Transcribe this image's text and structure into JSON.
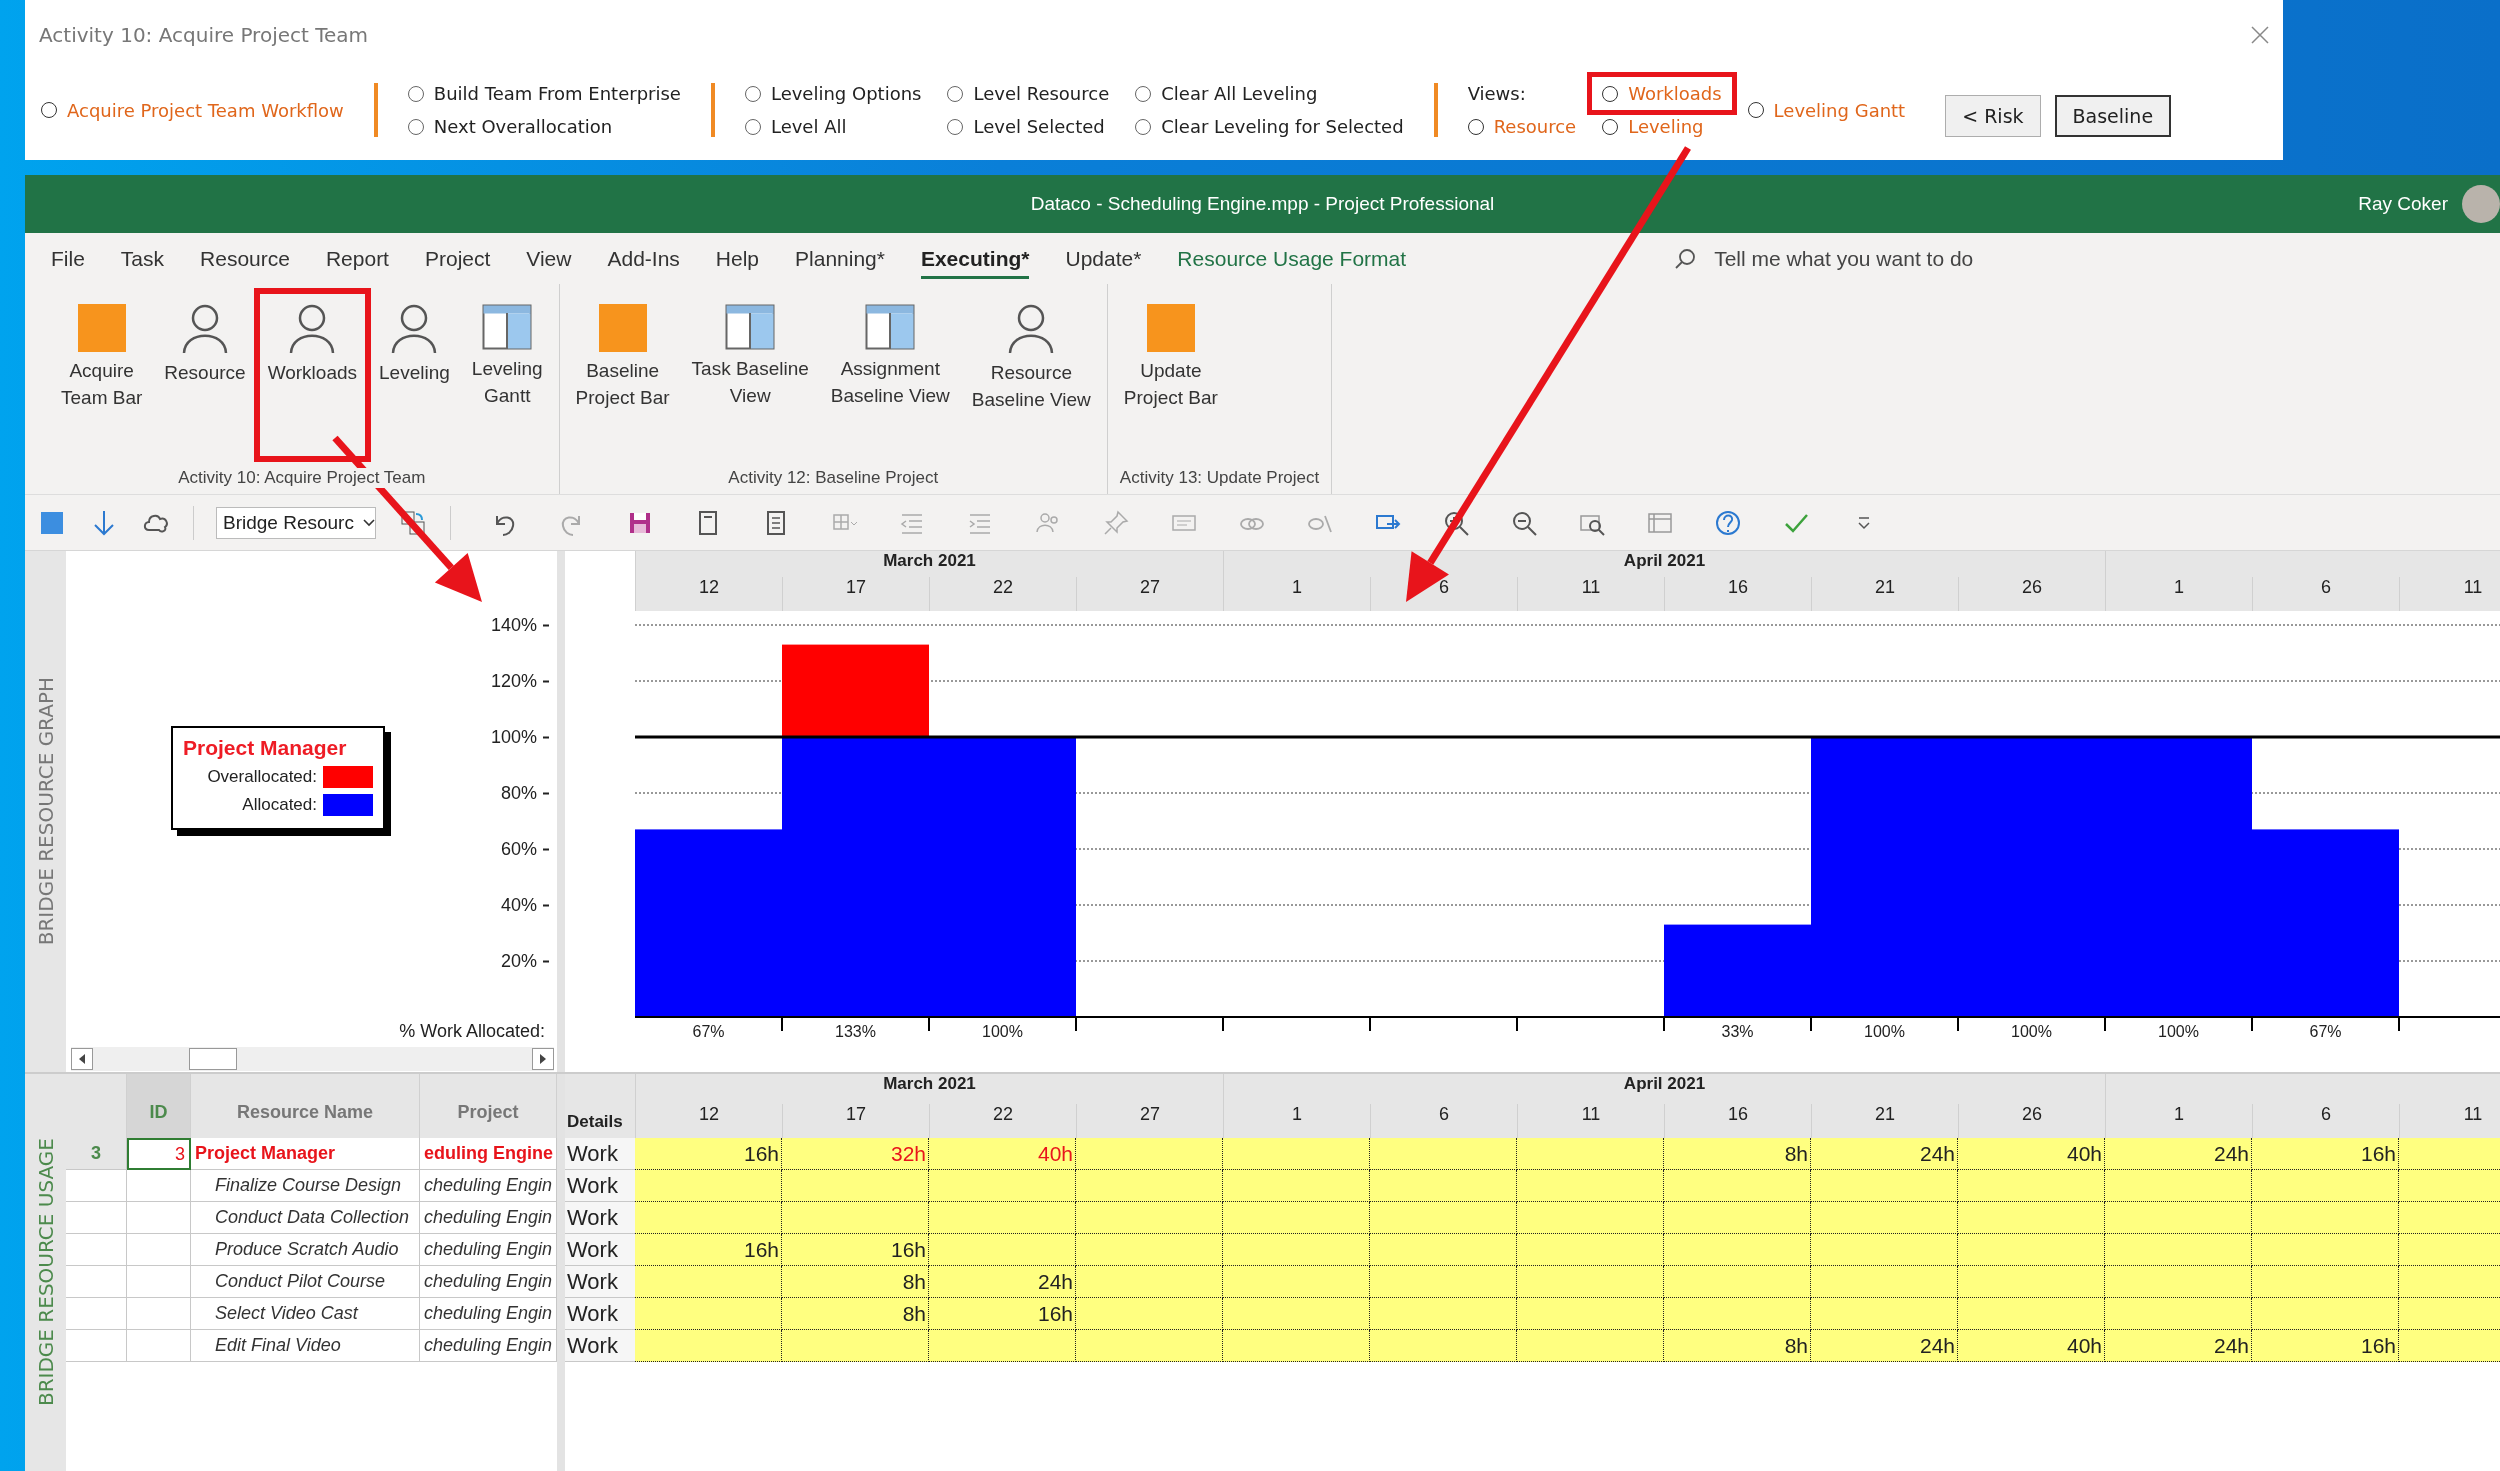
{
  "dialog": {
    "title": "Activity 10: Acquire Project Team",
    "groups": [
      {
        "items": [
          {
            "kind": "radio",
            "label": "Acquire Project Team Workflow",
            "accent": true,
            "selected": false,
            "annotated": false
          }
        ]
      },
      {
        "items": [
          {
            "kind": "radio",
            "label": "Build Team From Enterprise",
            "accent": false,
            "selected": false,
            "annotated": false
          },
          {
            "kind": "radio",
            "label": "Next Overallocation",
            "accent": false,
            "selected": false,
            "annotated": false
          }
        ]
      },
      {
        "items": [
          {
            "kind": "radio",
            "label": "Leveling Options",
            "accent": false,
            "selected": false,
            "annotated": false
          },
          {
            "kind": "radio",
            "label": "Level All",
            "accent": false,
            "selected": false,
            "annotated": false
          },
          {
            "kind": "radio",
            "label": "Level Resource",
            "accent": false,
            "selected": false,
            "annotated": false
          },
          {
            "kind": "radio",
            "label": "Level Selected",
            "accent": false,
            "selected": false,
            "annotated": false
          },
          {
            "kind": "radio",
            "label": "Clear All Leveling",
            "accent": false,
            "selected": false,
            "annotated": false
          },
          {
            "kind": "radio",
            "label": "Clear Leveling for Selected",
            "accent": false,
            "selected": false,
            "annotated": false
          }
        ]
      },
      {
        "items": [
          {
            "kind": "label",
            "label": "Views:"
          },
          {
            "kind": "radio",
            "label": "Resource",
            "accent": true,
            "selected": false,
            "annotated": false
          },
          {
            "kind": "radio",
            "label": "Workloads",
            "accent": true,
            "selected": false,
            "annotated": true
          },
          {
            "kind": "radio",
            "label": "Leveling",
            "accent": true,
            "selected": false,
            "annotated": false
          },
          {
            "kind": "radio",
            "label": "Leveling Gantt",
            "accent": true,
            "selected": false,
            "annotated": false
          }
        ]
      }
    ],
    "buttons": [
      {
        "label": "< Risk",
        "default": false
      },
      {
        "label": "Baseline",
        "default": true
      }
    ]
  },
  "window": {
    "title": "Dataco - Scheduling Engine.mpp  -  Project Professional",
    "user": "Ray Coker"
  },
  "menu": [
    {
      "label": "File",
      "kind": "tab",
      "selected": false
    },
    {
      "label": "Task",
      "kind": "tab",
      "selected": false
    },
    {
      "label": "Resource",
      "kind": "tab",
      "selected": false
    },
    {
      "label": "Report",
      "kind": "tab",
      "selected": false
    },
    {
      "label": "Project",
      "kind": "tab",
      "selected": false
    },
    {
      "label": "View",
      "kind": "tab",
      "selected": false
    },
    {
      "label": "Add-Ins",
      "kind": "tab",
      "selected": false
    },
    {
      "label": "Help",
      "kind": "tab",
      "selected": false
    },
    {
      "label": "Planning*",
      "kind": "tab",
      "selected": false
    },
    {
      "label": "Executing*",
      "kind": "tab",
      "selected": true
    },
    {
      "label": "Update*",
      "kind": "tab",
      "selected": false
    },
    {
      "label": "Resource Usage Format",
      "kind": "contextual",
      "selected": false
    }
  ],
  "search": {
    "placeholder": "Tell me what you want to do"
  },
  "ribbon": [
    {
      "label": "Activity 10: Acquire Project Team",
      "buttons": [
        {
          "label": "Acquire\nTeam Bar",
          "kind": "bar",
          "annotated": false
        },
        {
          "label": "Resource",
          "kind": "person",
          "annotated": false
        },
        {
          "label": "Workloads",
          "kind": "person",
          "annotated": true
        },
        {
          "label": "Leveling",
          "kind": "person",
          "annotated": false
        },
        {
          "label": "Leveling\nGantt",
          "kind": "view",
          "annotated": false
        }
      ]
    },
    {
      "label": "Activity 12: Baseline Project",
      "buttons": [
        {
          "label": "Baseline\nProject Bar",
          "kind": "bar",
          "annotated": false
        },
        {
          "label": "Task Baseline\nView",
          "kind": "view",
          "annotated": false
        },
        {
          "label": "Assignment\nBaseline View",
          "kind": "view",
          "annotated": false
        },
        {
          "label": "Resource\nBaseline View",
          "kind": "person",
          "annotated": false
        }
      ]
    },
    {
      "label": "Activity 13: Update Project",
      "buttons": [
        {
          "label": "Update\nProject Bar",
          "kind": "bar",
          "annotated": false
        }
      ]
    }
  ],
  "toolbar": {
    "dropdown": "Bridge Resourc"
  },
  "graph": {
    "side_label": "BRIDGE RESOURCE GRAPH",
    "axis_caption": "% Work Allocated:",
    "months": [
      "March 2021",
      "April 2021"
    ],
    "chart_data": {
      "type": "bar",
      "stacked": true,
      "categories": [
        "12",
        "17",
        "22",
        "27",
        "1",
        "6",
        "11",
        "16",
        "21",
        "26",
        "1",
        "6",
        "11"
      ],
      "grid": true,
      "ylim": [
        0,
        140
      ],
      "legend": {
        "title": "Project Manager"
      },
      "yticks": [
        {
          "value": 20,
          "label": "20%"
        },
        {
          "value": 40,
          "label": "40%"
        },
        {
          "value": 60,
          "label": "60%"
        },
        {
          "value": 80,
          "label": "80%"
        },
        {
          "value": 100,
          "label": "100%"
        },
        {
          "value": 120,
          "label": "120%"
        },
        {
          "value": 140,
          "label": "140%"
        }
      ],
      "series": [
        {
          "name": "Allocated:",
          "color": "#0000ff",
          "values": [
            67,
            100,
            100,
            0,
            0,
            0,
            0,
            33,
            100,
            100,
            100,
            67,
            0
          ]
        },
        {
          "name": "Overallocated:",
          "color": "#ff0000",
          "values": [
            0,
            33,
            0,
            0,
            0,
            0,
            0,
            0,
            0,
            0,
            0,
            0,
            0
          ]
        }
      ],
      "value_labels": [
        "67%",
        "133%",
        "100%",
        null,
        null,
        null,
        null,
        "33%",
        "100%",
        "100%",
        "100%",
        "67%",
        null
      ],
      "ref_lines": [
        {
          "axis": "y",
          "value": 100
        }
      ]
    }
  },
  "usage": {
    "side_label": "BRIDGE RESOURCE USAGE",
    "columns": [
      "ID",
      "Resource Name",
      "Project"
    ],
    "details_header": "Details",
    "timescale": [
      {
        "month": "March 2021",
        "days": [
          "12",
          "17",
          "22",
          "27"
        ]
      },
      {
        "month": "April 2021",
        "days": [
          "1",
          "6",
          "11",
          "16",
          "21",
          "26"
        ]
      },
      {
        "days": [
          "1",
          "6",
          "11"
        ]
      }
    ],
    "rows": [
      {
        "row_header": "3",
        "id": "3",
        "name": "Project Manager",
        "project": "eduling Engine",
        "details": "Work",
        "selected": true,
        "overallocated": true,
        "cells": [
          {
            "text": "16h",
            "overallocated": false
          },
          {
            "text": "32h",
            "overallocated": true
          },
          {
            "text": "40h",
            "overallocated": true
          },
          null,
          null,
          null,
          null,
          {
            "text": "8h",
            "overallocated": false
          },
          {
            "text": "24h",
            "overallocated": false
          },
          {
            "text": "40h",
            "overallocated": false
          },
          {
            "text": "24h",
            "overallocated": false
          },
          {
            "text": "16h",
            "overallocated": false
          },
          null
        ],
        "children": [
          {
            "name": "Finalize Course Design",
            "project": "cheduling Engin",
            "details": "Work",
            "selected": false,
            "overallocated": false,
            "cells": [
              null,
              null,
              null,
              null,
              null,
              null,
              null,
              null,
              null,
              null,
              null,
              null,
              null
            ]
          },
          {
            "name": "Conduct Data Collection",
            "project": "cheduling Engin",
            "details": "Work",
            "selected": false,
            "overallocated": false,
            "cells": [
              null,
              null,
              null,
              null,
              null,
              null,
              null,
              null,
              null,
              null,
              null,
              null,
              null
            ]
          },
          {
            "name": "Produce Scratch Audio",
            "project": "cheduling Engin",
            "details": "Work",
            "selected": false,
            "overallocated": false,
            "cells": [
              {
                "text": "16h",
                "overallocated": false
              },
              {
                "text": "16h",
                "overallocated": false
              },
              null,
              null,
              null,
              null,
              null,
              null,
              null,
              null,
              null,
              null,
              null
            ]
          },
          {
            "name": "Conduct Pilot Course",
            "project": "cheduling Engin",
            "details": "Work",
            "selected": false,
            "overallocated": false,
            "cells": [
              null,
              {
                "text": "8h",
                "overallocated": false
              },
              {
                "text": "24h",
                "overallocated": false
              },
              null,
              null,
              null,
              null,
              null,
              null,
              null,
              null,
              null,
              null
            ]
          },
          {
            "name": "Select Video Cast",
            "project": "cheduling Engin",
            "details": "Work",
            "selected": false,
            "overallocated": false,
            "cells": [
              null,
              {
                "text": "8h",
                "overallocated": false
              },
              {
                "text": "16h",
                "overallocated": false
              },
              null,
              null,
              null,
              null,
              null,
              null,
              null,
              null,
              null,
              null
            ]
          },
          {
            "name": "Edit Final Video",
            "project": "cheduling Engin",
            "details": "Work",
            "selected": false,
            "overallocated": false,
            "cells": [
              null,
              null,
              null,
              null,
              null,
              null,
              null,
              {
                "text": "8h",
                "overallocated": false
              },
              {
                "text": "24h",
                "overallocated": false
              },
              {
                "text": "40h",
                "overallocated": false
              },
              {
                "text": "24h",
                "overallocated": false
              },
              {
                "text": "16h",
                "overallocated": false
              },
              null
            ]
          }
        ]
      }
    ]
  }
}
